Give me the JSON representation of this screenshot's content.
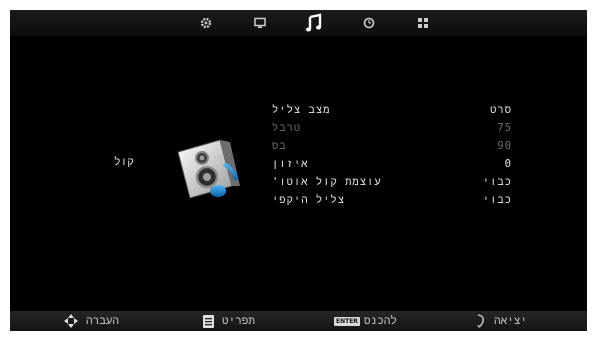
{
  "tabs": [
    {
      "icon": "gear-icon"
    },
    {
      "icon": "monitor-icon"
    },
    {
      "icon": "music-note-icon",
      "selected": true
    },
    {
      "icon": "clock-icon"
    },
    {
      "icon": "grid-icon"
    }
  ],
  "menu": {
    "section_label": "קול",
    "section_icon": "speaker-music-icon",
    "items": [
      {
        "label": "מצב צליל",
        "value": "סרט",
        "enabled": true
      },
      {
        "label": "טרבל",
        "value": "75",
        "enabled": false
      },
      {
        "label": "בס",
        "value": "90",
        "enabled": false
      },
      {
        "label": "איזון",
        "value": "0",
        "enabled": true
      },
      {
        "label": "עוצמת קול אוטו'",
        "value": "כבוי",
        "enabled": true
      },
      {
        "label": "צליל היקפי",
        "value": "כבוי",
        "enabled": true
      }
    ]
  },
  "footer": {
    "move": {
      "label": "העברה",
      "icon": "dpad-icon"
    },
    "menu": {
      "label": "תפריט",
      "icon": "menu-icon"
    },
    "enter": {
      "label": "להכנס",
      "key": "ENTER"
    },
    "exit": {
      "label": "יציאה",
      "icon": "exit-icon"
    }
  },
  "colors": {
    "background": "#000000",
    "text_enabled": "#e6e6e6",
    "text_disabled": "#6c6c6c",
    "accent": "#1e90d8"
  }
}
